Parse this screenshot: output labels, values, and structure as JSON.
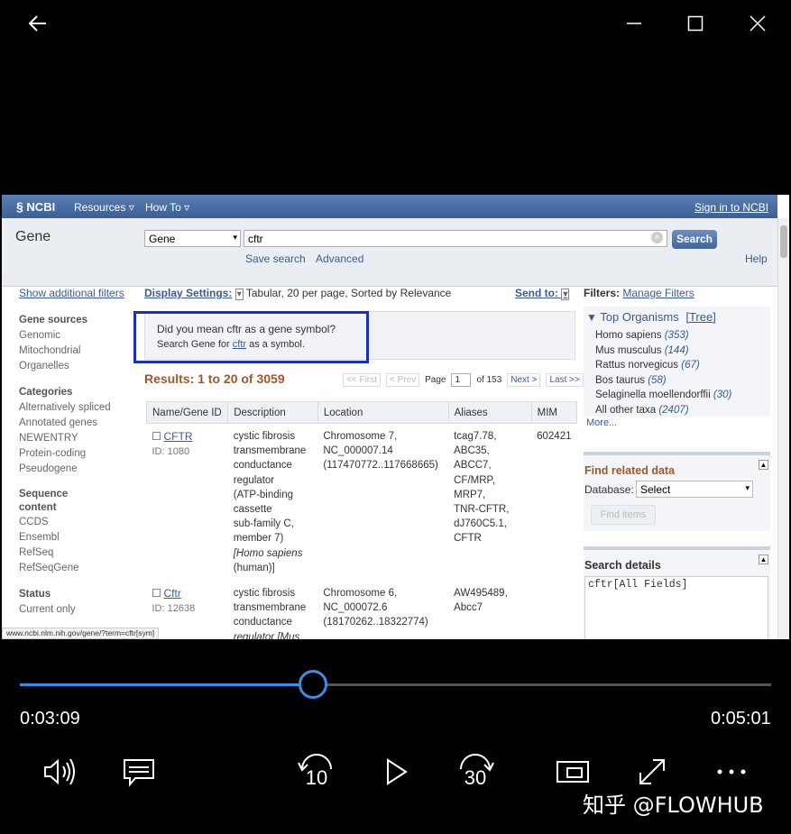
{
  "window": {
    "back_icon": "back-arrow-icon",
    "minimize_icon": "minimize-icon",
    "maximize_icon": "maximize-icon",
    "close_icon": "close-icon"
  },
  "ncbi": {
    "logo": "NCBI",
    "menu_resources": "Resources",
    "menu_howto": "How To",
    "signin": "Sign in to NCBI",
    "db_title": "Gene",
    "db_select": "Gene",
    "search_value": "cftr",
    "search_button": "Search",
    "save_search": "Save search",
    "advanced": "Advanced",
    "help": "Help",
    "show_filters": "Show additional filters",
    "display_settings_label": "Display Settings:",
    "display_settings_value": "Tabular, 20 per page, Sorted by Relevance",
    "send_to": "Send to:",
    "suggestion_line1": "Did you mean cftr as a gene symbol?",
    "suggestion_line2_pre": "Search Gene for",
    "suggestion_link": "cftr",
    "suggestion_line2_post": "as a symbol.",
    "results_title": "Results: 1 to 20 of 3059",
    "pager": {
      "first": "<< First",
      "prev": "< Prev",
      "page_label": "Page",
      "page_value": "1",
      "of": "of 153",
      "next": "Next >",
      "last": "Last >>"
    },
    "sidebar": {
      "gene_sources_h": "Gene sources",
      "gene_sources": [
        "Genomic",
        "Mitochondrial",
        "Organelles"
      ],
      "categories_h": "Categories",
      "categories": [
        "Alternatively spliced",
        "Annotated genes",
        "NEWENTRY",
        "Protein-coding",
        "Pseudogene"
      ],
      "sequence_h1": "Sequence",
      "sequence_h2": "content",
      "sequence": [
        "CCDS",
        "Ensembl",
        "RefSeq",
        "RefSeqGene"
      ],
      "status_h": "Status",
      "status": [
        "Current only"
      ]
    },
    "table": {
      "headers": [
        "Name/Gene ID",
        "Description",
        "Location",
        "Aliases",
        "MIM"
      ],
      "rows": [
        {
          "name": "CFTR",
          "id": "ID: 1080",
          "desc_lines": [
            "cystic fibrosis",
            "transmembrane",
            "conductance",
            "regulator",
            "(ATP-binding",
            "cassette",
            "sub-family C,",
            "member 7)"
          ],
          "desc_species": "[Homo sapiens",
          "desc_species_end": "(human)]",
          "loc_lines": [
            "Chromosome 7,",
            "NC_000007.14",
            "(117470772..117668665)"
          ],
          "alias_lines": [
            "tcag7.78,",
            "ABC35,",
            "ABCC7,",
            "CF/MRP,",
            "MRP7,",
            "TNR-CFTR,",
            "dJ760C5.1,",
            "CFTR"
          ],
          "mim": "602421"
        },
        {
          "name": "Cftr",
          "id": "ID: 12638",
          "desc_lines": [
            "cystic fibrosis",
            "transmembrane",
            "conductance"
          ],
          "desc_species": "regulator [Mus",
          "desc_species_end": "",
          "loc_lines": [
            "Chromosome 6,",
            "NC_000072.6",
            "(18170262..18322774)"
          ],
          "alias_lines": [
            "AW495489,",
            "Abcc7"
          ],
          "mim": ""
        }
      ]
    },
    "filters_label": "Filters:",
    "manage_filters": "Manage Filters",
    "top_organisms": "Top Organisms",
    "tree": "[Tree]",
    "organisms": [
      {
        "name": "Homo sapiens",
        "count": "(353)"
      },
      {
        "name": "Mus musculus",
        "count": "(144)"
      },
      {
        "name": "Rattus norvegicus",
        "count": "(67)"
      },
      {
        "name": "Bos taurus",
        "count": "(58)"
      },
      {
        "name": "Selaginella moellendorffii",
        "count": "(30)"
      },
      {
        "name": "All other taxa",
        "count": "(2407)"
      }
    ],
    "more": "More...",
    "find_related": "Find related data",
    "database_label": "Database:",
    "database_value": "Select",
    "find_items": "Find items",
    "search_details": "Search details",
    "search_details_value": "cftr[All Fields]",
    "status_url": "www.ncbi.nlm.nih.gov/gene/?term=cftr[sym]"
  },
  "player": {
    "current_time": "0:03:09",
    "total_time": "0:05:01",
    "progress_fraction": 0.39,
    "skip_back": "10",
    "skip_forward": "30",
    "accent_color": "#3a8ee6"
  },
  "watermark": "知乎 @FLOWHUB"
}
